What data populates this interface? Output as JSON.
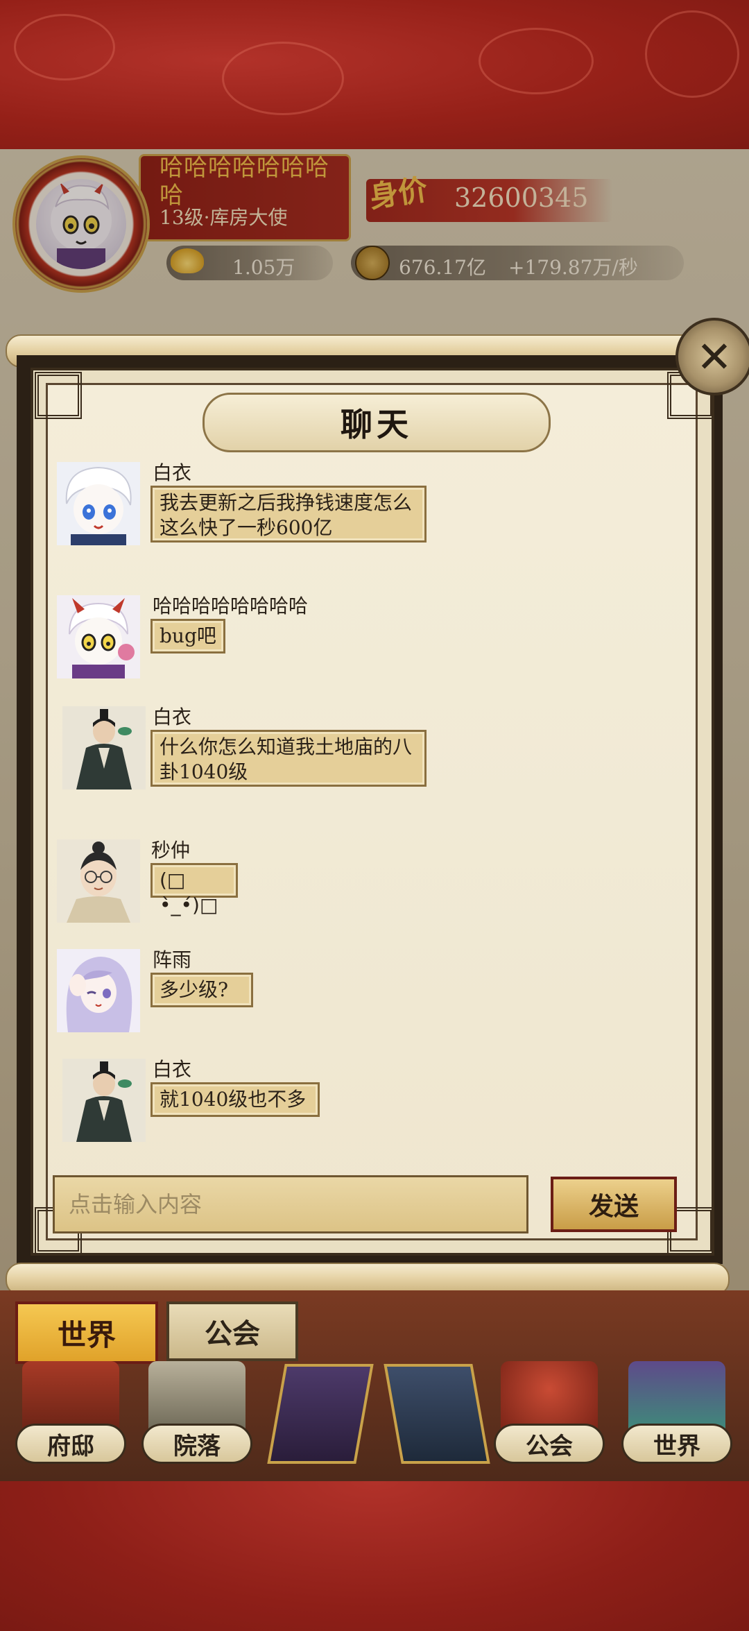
{
  "player": {
    "name": "哈哈哈哈哈哈哈哈",
    "title": "13级·库房大使",
    "worth_label": "身价",
    "worth_value": "32600345"
  },
  "resources": {
    "ingot": "1.05万",
    "coins": "676.17亿",
    "rate": "+179.87万/秒"
  },
  "chat": {
    "title": "聊天",
    "messages": [
      {
        "name": "白衣",
        "text": "我去更新之后我挣钱速度怎么这么快了一秒600亿",
        "avatar": "anime-white-hair-avatar"
      },
      {
        "name": "哈哈哈哈哈哈哈哈",
        "text": "bug吧",
        "avatar": "anime-horned-avatar"
      },
      {
        "name": "白衣",
        "text": "什么你怎么知道我土地庙的八卦1040级",
        "avatar": "scholar-avatar"
      },
      {
        "name": "秒仲",
        "text": "(□ •̀_•́)□",
        "avatar": "glasses-man-avatar"
      },
      {
        "name": "阵雨",
        "text": "多少级?",
        "avatar": "purple-hair-girl-avatar"
      },
      {
        "name": "白衣",
        "text": "就1040级也不多",
        "avatar": "scholar-avatar"
      }
    ],
    "input_placeholder": "点击输入内容",
    "send_label": "发送"
  },
  "tabs": {
    "world": "世界",
    "guild": "公会"
  },
  "nav": [
    {
      "label": "府邸",
      "icon": "mansion-icon"
    },
    {
      "label": "院落",
      "icon": "courtyard-icon"
    },
    {
      "label": "",
      "icon": "treasure-icon"
    },
    {
      "label": "",
      "icon": "warrior-icon"
    },
    {
      "label": "公会",
      "icon": "guild-hall-icon"
    },
    {
      "label": "世界",
      "icon": "world-landscape-icon"
    }
  ],
  "colors": {
    "accent_red": "#8e1f18",
    "gold": "#f3c14b",
    "paper": "#f4edd9",
    "bubble": "#e5cf99"
  }
}
